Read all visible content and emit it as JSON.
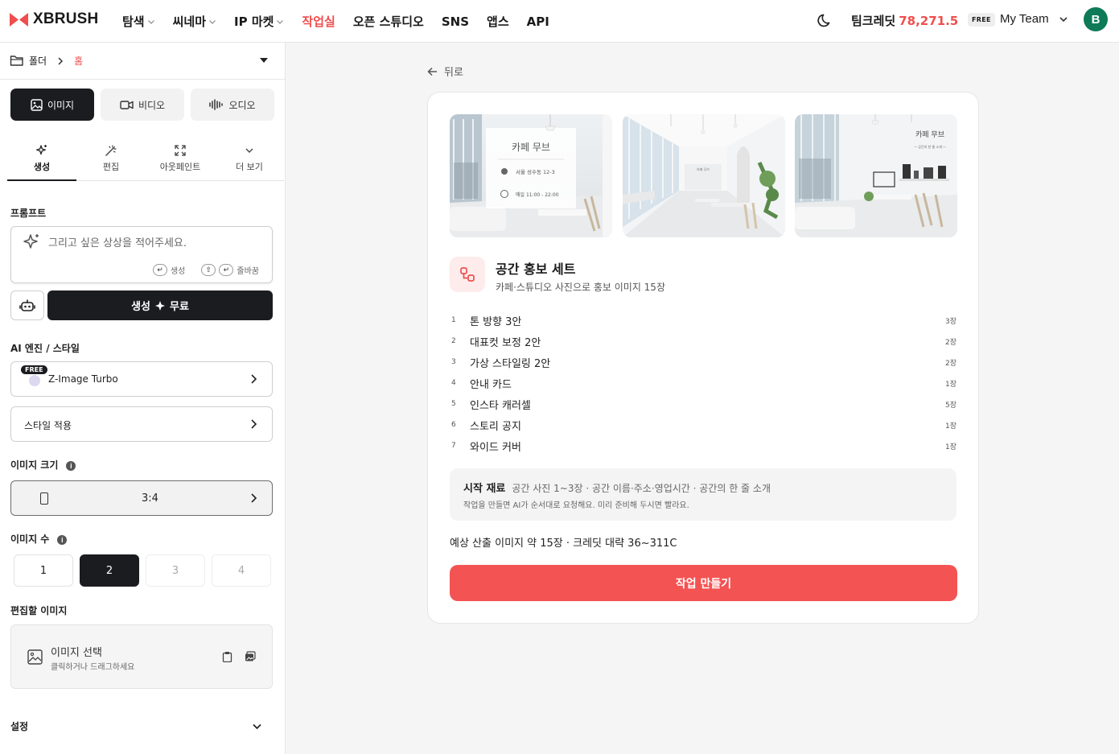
{
  "brand": {
    "name": "XBRUSH",
    "accent": "#f04e4e"
  },
  "nav": [
    {
      "label": "탐색",
      "dropdown": true
    },
    {
      "label": "씨네마",
      "dropdown": true
    },
    {
      "label": "IP 마켓",
      "dropdown": true
    },
    {
      "label": "작업실",
      "dropdown": false,
      "active": true
    },
    {
      "label": "오픈 스튜디오",
      "dropdown": false
    },
    {
      "label": "SNS",
      "dropdown": false
    },
    {
      "label": "앱스",
      "dropdown": false
    },
    {
      "label": "API",
      "dropdown": false
    }
  ],
  "header": {
    "credit_label": "팀크레딧",
    "credit_value": "78,271.5",
    "plan_badge": "FREE",
    "team_name": "My Team",
    "avatar_letter": "B"
  },
  "sidebar": {
    "folder_label": "폴더",
    "folder_current": "홈",
    "media_tabs": [
      {
        "label": "이미지",
        "icon": "image-icon",
        "active": true
      },
      {
        "label": "비디오",
        "icon": "video-icon",
        "active": false
      },
      {
        "label": "오디오",
        "icon": "audio-icon",
        "active": false
      }
    ],
    "sub_tabs": [
      {
        "label": "생성",
        "icon": "sparkle-icon",
        "active": true
      },
      {
        "label": "편집",
        "icon": "magic-wand-icon",
        "active": false
      },
      {
        "label": "아웃페인트",
        "icon": "expand-icon",
        "active": false
      },
      {
        "label": "더 보기",
        "icon": "chevron-down-icon",
        "active": false
      }
    ],
    "prompt_label": "프롬프트",
    "prompt_placeholder": "그리고 싶은 상상을 적어주세요.",
    "hint_generate": "생성",
    "hint_newline": "줄바꿈",
    "generate_label": "생성",
    "generate_cost": "무료",
    "engine_label": "AI 엔진 / 스타일",
    "engine_badge": "FREE",
    "engine_name": "Z-Image Turbo",
    "style_label": "스타일 적용",
    "size_label": "이미지 크기",
    "ratio_value": "3:4",
    "count_label": "이미지 수",
    "counts": [
      {
        "label": "1",
        "state": "normal"
      },
      {
        "label": "2",
        "state": "active"
      },
      {
        "label": "3",
        "state": "disabled"
      },
      {
        "label": "4",
        "state": "disabled"
      }
    ],
    "edit_image_label": "편집할 이미지",
    "image_select_title": "이미지 선택",
    "image_select_hint": "클릭하거나 드래그하세요",
    "settings_label": "설정"
  },
  "main": {
    "back_label": "뒤로",
    "thumbnails": [
      {
        "title": "카페 무브",
        "address": "서울 성수동 12-3",
        "hours": "매일 11:00 - 22:00"
      },
      {
        "sign": "카페 무브"
      },
      {
        "title": "카페 무브",
        "subtitle": "— 공간의 한 줄 소개 —"
      }
    ],
    "set_title": "공간 홍보 세트",
    "set_subtitle": "카페·스튜디오 사진으로 홍보 이미지 15장",
    "items": [
      {
        "num": "1",
        "label": "톤 방향 3안",
        "count": "3장"
      },
      {
        "num": "2",
        "label": "대표컷 보정 2안",
        "count": "2장"
      },
      {
        "num": "3",
        "label": "가상 스타일링 2안",
        "count": "2장"
      },
      {
        "num": "4",
        "label": "안내 카드",
        "count": "1장"
      },
      {
        "num": "5",
        "label": "인스타 캐러셀",
        "count": "5장"
      },
      {
        "num": "6",
        "label": "스토리 공지",
        "count": "1장"
      },
      {
        "num": "7",
        "label": "와이드 커버",
        "count": "1장"
      }
    ],
    "materials_title": "시작 재료",
    "materials_list": "공간 사진 1~3장 · 공간 이름·주소·영업시간 · 공간의 한 줄 소개",
    "materials_note": "작업을 만들면 AI가 순서대로 요청해요. 미리 준비해 두시면 빨라요.",
    "estimate": "예상 산출 이미지 약 15장 · 크레딧 대략 36~311C",
    "create_button": "작업 만들기"
  }
}
